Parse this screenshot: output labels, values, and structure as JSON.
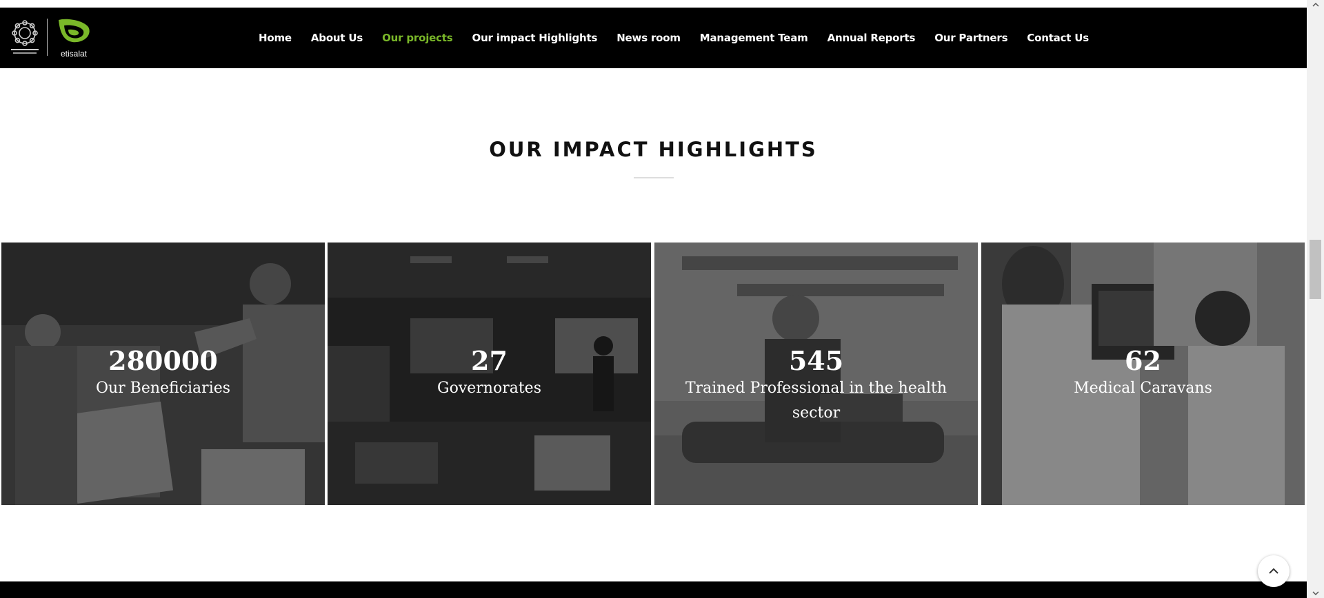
{
  "brand": {
    "foundation_logo_icon": "foundation-star-emblem-icon",
    "etisalat_logo_icon": "etisalat-logo-icon",
    "etisalat_wordmark": "etisalat",
    "accent_color": "#7ab829"
  },
  "nav": {
    "items": [
      {
        "label": "Home",
        "active": false
      },
      {
        "label": "About Us",
        "active": false
      },
      {
        "label": "Our projects",
        "active": true
      },
      {
        "label": "Our impact Highlights",
        "active": false
      },
      {
        "label": "News room",
        "active": false
      },
      {
        "label": "Management Team",
        "active": false
      },
      {
        "label": "Annual Reports",
        "active": false
      },
      {
        "label": "Our Partners",
        "active": false
      },
      {
        "label": "Contact Us",
        "active": false
      }
    ]
  },
  "section": {
    "title": "OUR IMPACT HIGHLIGHTS"
  },
  "highlights": [
    {
      "number": "280000",
      "label": "Our Beneficiaries"
    },
    {
      "number": "27",
      "label": "Governorates"
    },
    {
      "number": "545",
      "label": "Trained Professional in the health sector"
    },
    {
      "number": "62",
      "label": "Medical Caravans"
    }
  ],
  "controls": {
    "scroll_top_icon": "chevron-up-icon"
  }
}
